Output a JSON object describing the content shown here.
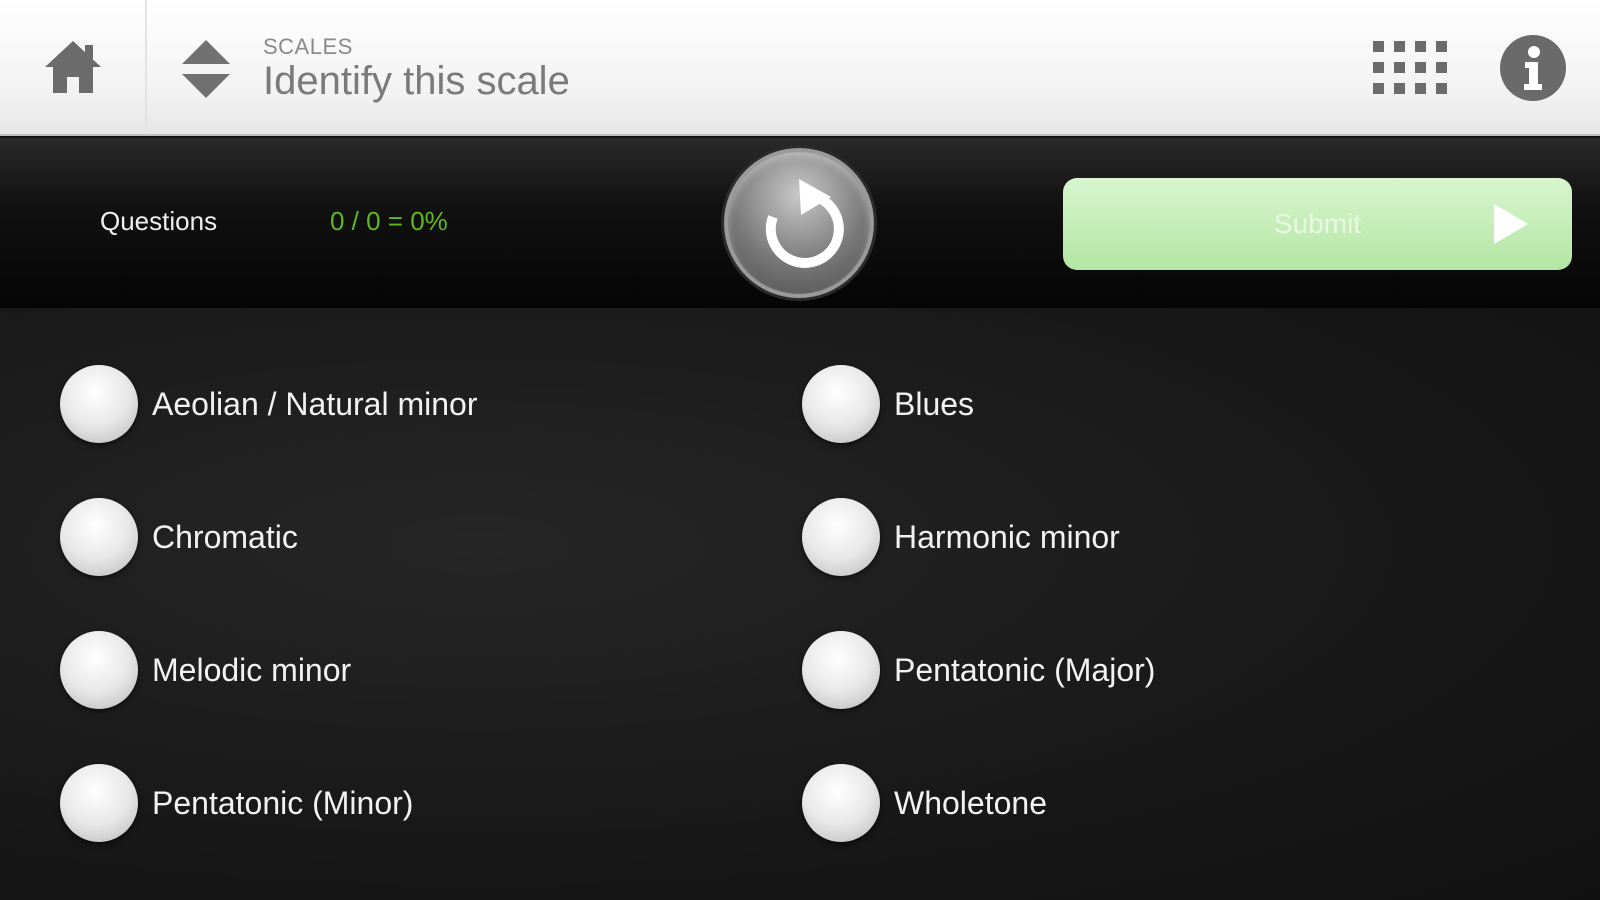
{
  "header": {
    "section": "SCALES",
    "title": "Identify this scale",
    "icons": {
      "home": "home-icon",
      "updown": "up-down-arrows-icon",
      "grid": "grid-menu-icon",
      "info": "info-icon"
    }
  },
  "toolbar": {
    "questions_label": "Questions",
    "score": "0 / 0 = 0%",
    "replay_icon": "replay-icon",
    "submit_label": "Submit",
    "submit_icon": "play-arrow-icon"
  },
  "options": [
    {
      "label": "Aeolian / Natural minor"
    },
    {
      "label": "Blues"
    },
    {
      "label": "Chromatic"
    },
    {
      "label": "Harmonic minor"
    },
    {
      "label": "Melodic minor"
    },
    {
      "label": "Pentatonic (Major)"
    },
    {
      "label": "Pentatonic (Minor)"
    },
    {
      "label": "Wholetone"
    }
  ],
  "colors": {
    "score_green": "#5fb81c",
    "submit_bg": "#b3e6a3",
    "header_text": "#7a7a7a"
  }
}
